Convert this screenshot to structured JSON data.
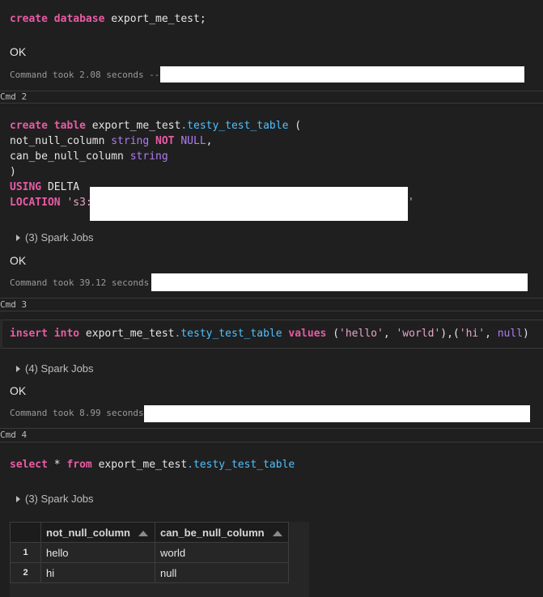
{
  "cmd1": {
    "code_kw1": "create",
    "code_kw2": "database",
    "code_rest": " export_me_test;",
    "ok": "OK",
    "took": "Command took 2.08 seconds --"
  },
  "cmd2": {
    "label": "Cmd 2",
    "l1_kw1": "create",
    "l1_kw2": "table",
    "l1_a": " export_me_test",
    "l1_tbl": ".testy_test_table",
    "l1_b": " (",
    "l2_a": "not_null_column ",
    "l2_type": "string",
    "l2_kw": " NOT",
    "l2_null": " NULL",
    "l2_b": ",",
    "l3_a": "can_be_null_column ",
    "l3_type": "string",
    "l4": ")",
    "l5_kw": "USING",
    "l5_rest": " DELTA",
    "l6_kw": "LOCATION",
    "l6_str": " 's3:",
    "l6_end": "'",
    "spark": "(3) Spark Jobs",
    "ok": "OK",
    "took": "Command took 39.12 seconds"
  },
  "cmd3": {
    "label": "Cmd 3",
    "kw1": "insert",
    "kw2": "into",
    "a": " export_me_test",
    "tbl": ".testy_test_table",
    "kw3": " values",
    "b": " (",
    "s1": "'hello'",
    "c1": ", ",
    "s2": "'world'",
    "c2": "),(",
    "s3": "'hi'",
    "c3": ", ",
    "nul": "null",
    "c4": ")",
    "spark": "(4) Spark Jobs",
    "ok": "OK",
    "took": "Command took 8.99 seconds"
  },
  "cmd4": {
    "label": "Cmd 4",
    "kw1": "select",
    "star": " * ",
    "kw2": "from",
    "a": " export_me_test",
    "tbl": ".testy_test_table",
    "spark": "(3) Spark Jobs",
    "columns": [
      "not_null_column",
      "can_be_null_column"
    ],
    "rows": [
      {
        "idx": "1",
        "c1": "hello",
        "c2": "world"
      },
      {
        "idx": "2",
        "c1": "hi",
        "c2": "null"
      }
    ]
  }
}
